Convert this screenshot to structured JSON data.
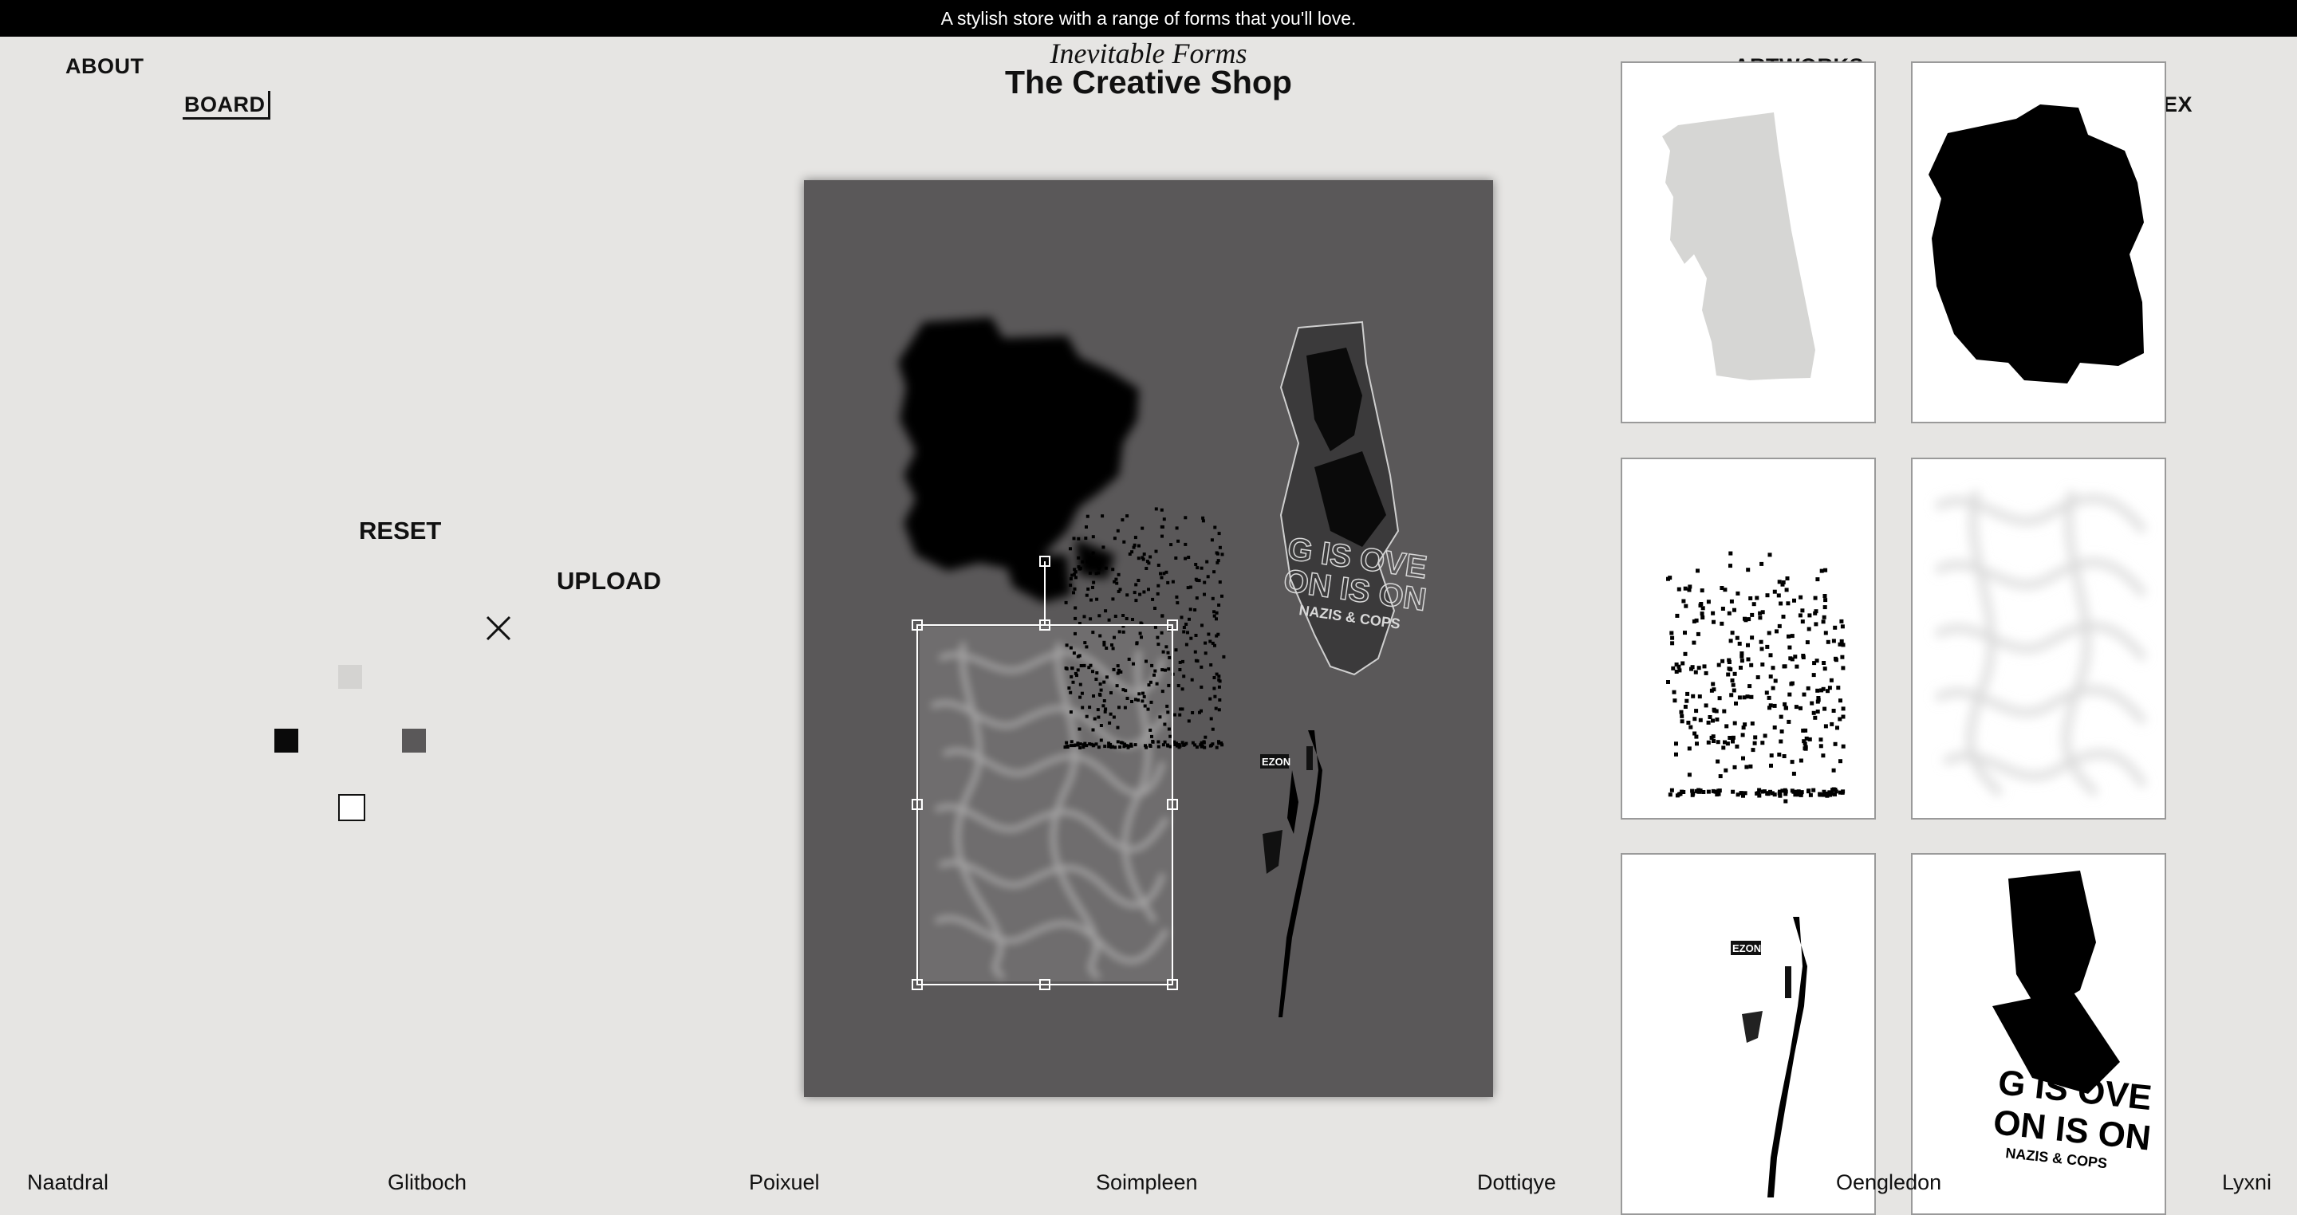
{
  "banner": {
    "text": "A stylish store with a range of forms that you'll love."
  },
  "nav": {
    "about": "ABOUT",
    "board": "BOARD",
    "artworks": "ARTWORKS",
    "index": "INDEX"
  },
  "brand": {
    "subtitle": "Inevitable Forms",
    "title": "The Creative Shop"
  },
  "controls": {
    "reset": "RESET",
    "upload": "UPLOAD",
    "close_icon": "close-icon",
    "swatches": [
      {
        "name": "light-gray",
        "color": "#d4d3d1"
      },
      {
        "name": "black",
        "color": "#0a0a0a"
      },
      {
        "name": "dark-gray",
        "color": "#5a5859"
      },
      {
        "name": "white",
        "color": "#ffffff"
      }
    ]
  },
  "canvas": {
    "background": "#5a5859",
    "selection_color": "#ffffff"
  },
  "thumbnails": [
    {
      "name": "pixel-silhouette"
    },
    {
      "name": "black-blob"
    },
    {
      "name": "dotted-scatter"
    },
    {
      "name": "soft-blur"
    },
    {
      "name": "glitch-strip"
    },
    {
      "name": "poster-fragment"
    }
  ],
  "thumbnail_texts": {
    "poster_line1": "G IS OVE",
    "poster_line2": "ON IS ON",
    "poster_line3": "NAZIS & COPS",
    "glitch_tag": "EZON"
  },
  "footer": [
    "Naatdral",
    "Glitboch",
    "Poixuel",
    "Soimpleen",
    "Dottiqye",
    "Oengledon",
    "Lyxni"
  ]
}
